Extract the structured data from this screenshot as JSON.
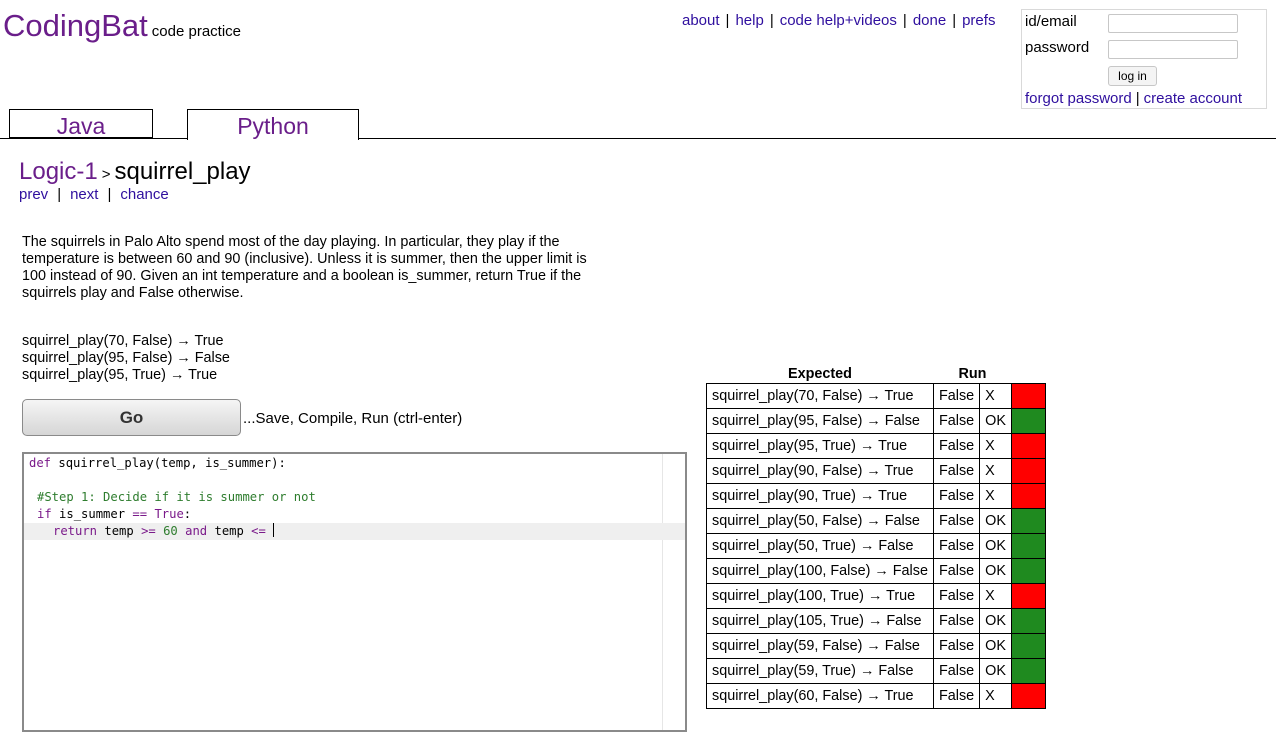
{
  "brand": {
    "logo": "CodingBat",
    "tagline": "code practice"
  },
  "topnav": [
    "about",
    "help",
    "code help+videos",
    "done",
    "prefs"
  ],
  "login": {
    "id_label": "id/email",
    "password_label": "password",
    "button": "log in",
    "forgot": "forgot password",
    "create": "create account"
  },
  "tabs": {
    "java": "Java",
    "python": "Python"
  },
  "breadcrumb": {
    "section": "Logic-1",
    "separator": ">",
    "problem": "squirrel_play"
  },
  "pager": {
    "prev": "prev",
    "next": "next",
    "chance": "chance"
  },
  "description": {
    "lines": [
      "The squirrels in Palo Alto spend most of the day playing. In particular, they play if the",
      "temperature is between 60 and 90 (inclusive). Unless it is summer, then the upper limit is",
      "100 instead of 90. Given an int temperature and a boolean is_summer, return True if the",
      "squirrels play and False otherwise."
    ]
  },
  "examples": [
    "squirrel_play(70, False) → True",
    "squirrel_play(95, False) → False",
    "squirrel_play(95, True) → True"
  ],
  "go": {
    "label": "Go",
    "note": "...Save, Compile, Run (ctrl-enter)"
  },
  "editor": {
    "line1": {
      "kw": "def",
      "rest": " squirrel_play(temp, is_summer):"
    },
    "line3": "#Step 1: Decide if it is summer or not",
    "line4": {
      "kw": "if",
      "a": " is_summer ",
      "op": "==",
      "b": " ",
      "val": "True",
      "c": ":"
    },
    "line5": {
      "kw": "return",
      "a": " temp ",
      "op1": ">=",
      "sp": " ",
      "num": "60",
      "sp2": " ",
      "and": "and",
      "b": " temp ",
      "op2": "<=",
      "c": " "
    }
  },
  "results": {
    "headers": {
      "expected": "Expected",
      "run": "Run"
    },
    "rows": [
      {
        "expected": "squirrel_play(70, False) → True",
        "run": "False",
        "result": "X",
        "status": "x"
      },
      {
        "expected": "squirrel_play(95, False) → False",
        "run": "False",
        "result": "OK",
        "status": "ok"
      },
      {
        "expected": "squirrel_play(95, True) → True",
        "run": "False",
        "result": "X",
        "status": "x"
      },
      {
        "expected": "squirrel_play(90, False) → True",
        "run": "False",
        "result": "X",
        "status": "x"
      },
      {
        "expected": "squirrel_play(90, True) → True",
        "run": "False",
        "result": "X",
        "status": "x"
      },
      {
        "expected": "squirrel_play(50, False) → False",
        "run": "False",
        "result": "OK",
        "status": "ok"
      },
      {
        "expected": "squirrel_play(50, True) → False",
        "run": "False",
        "result": "OK",
        "status": "ok"
      },
      {
        "expected": "squirrel_play(100, False) → False",
        "run": "False",
        "result": "OK",
        "status": "ok"
      },
      {
        "expected": "squirrel_play(100, True) → True",
        "run": "False",
        "result": "X",
        "status": "x"
      },
      {
        "expected": "squirrel_play(105, True) → False",
        "run": "False",
        "result": "OK",
        "status": "ok"
      },
      {
        "expected": "squirrel_play(59, False) → False",
        "run": "False",
        "result": "OK",
        "status": "ok"
      },
      {
        "expected": "squirrel_play(59, True) → False",
        "run": "False",
        "result": "OK",
        "status": "ok"
      },
      {
        "expected": "squirrel_play(60, False) → True",
        "run": "False",
        "result": "X",
        "status": "x"
      }
    ]
  },
  "colors": {
    "ok": "#1f8a1f",
    "x": "#ff0000",
    "brand": "#6a1e8a",
    "link": "#2f0f9e"
  }
}
